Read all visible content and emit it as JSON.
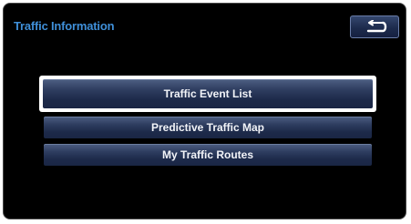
{
  "screen": {
    "title": "Traffic Information",
    "back_icon": "return-arrow-icon"
  },
  "menu": {
    "items": [
      {
        "label": "Traffic Event List",
        "selected": true
      },
      {
        "label": "Predictive Traffic Map",
        "selected": false
      },
      {
        "label": "My Traffic Routes",
        "selected": false
      }
    ]
  },
  "colors": {
    "title": "#3f8fd8",
    "button": "#2f3e61",
    "highlight": "#ffffff",
    "background": "#000000"
  }
}
